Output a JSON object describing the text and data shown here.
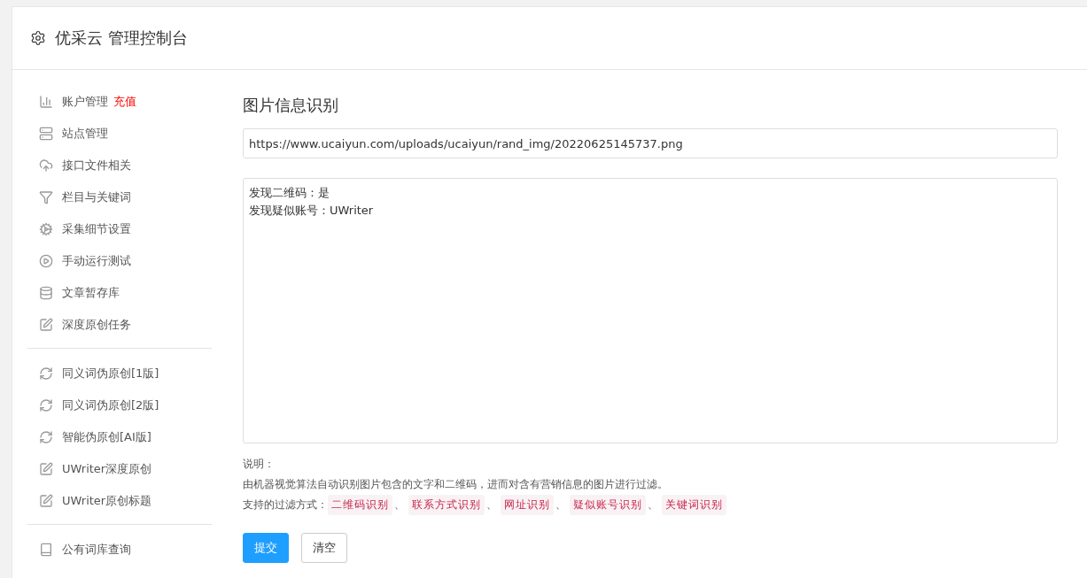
{
  "header": {
    "title": "优采云 管理控制台"
  },
  "sidebar": {
    "groups": [
      {
        "items": [
          {
            "kind": "chart",
            "label": "账户管理",
            "badge": "充值"
          },
          {
            "kind": "server",
            "label": "站点管理"
          },
          {
            "kind": "cloud",
            "label": "接口文件相关"
          },
          {
            "kind": "filter",
            "label": "栏目与关键词"
          },
          {
            "kind": "gears",
            "label": "采集细节设置"
          },
          {
            "kind": "play",
            "label": "手动运行测试"
          },
          {
            "kind": "database",
            "label": "文章暂存库"
          },
          {
            "kind": "edit",
            "label": "深度原创任务"
          }
        ]
      },
      {
        "items": [
          {
            "kind": "refresh",
            "label": "同义词伪原创[1版]"
          },
          {
            "kind": "refresh",
            "label": "同义词伪原创[2版]"
          },
          {
            "kind": "refresh",
            "label": "智能伪原创[AI版]"
          },
          {
            "kind": "edit",
            "label": "UWriter深度原创"
          },
          {
            "kind": "edit",
            "label": "UWriter原创标题"
          }
        ]
      },
      {
        "items": [
          {
            "kind": "book",
            "label": "公有词库查询"
          }
        ]
      }
    ]
  },
  "main": {
    "title": "图片信息识别",
    "url_field": {
      "value": "https://www.ucaiyun.com/uploads/ucaiyun/rand_img/20220625145737.png"
    },
    "result_field": {
      "lines": [
        "发现二维码：是",
        "发现疑似账号：UWriter"
      ]
    },
    "note_label": "说明：",
    "note_text": "由机器视觉算法自动识别图片包含的文字和二维码，进而对含有营销信息的图片进行过滤。",
    "filters_label": "支持的过滤方式：",
    "filters": [
      "二维码识别",
      "联系方式识别",
      "网址识别",
      "疑似账号识别",
      "关键词识别"
    ],
    "separator": "、",
    "buttons": [
      {
        "kind": "primary",
        "label": "提交"
      },
      {
        "kind": "default",
        "label": "清空"
      }
    ]
  }
}
